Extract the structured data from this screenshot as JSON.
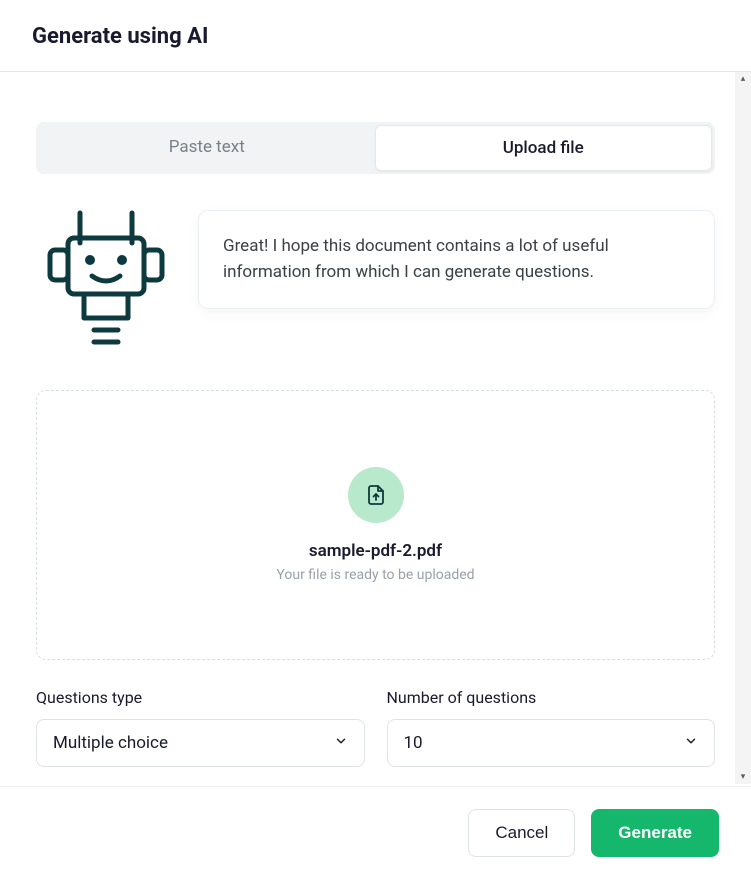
{
  "header": {
    "title": "Generate using AI"
  },
  "tabs": {
    "paste_text": "Paste text",
    "upload_file": "Upload file",
    "active": "upload_file"
  },
  "assistant": {
    "message": "Great! I hope this document contains a lot of useful information from which I can generate questions."
  },
  "dropzone": {
    "file_name": "sample-pdf-2.pdf",
    "hint": "Your file is ready to be uploaded",
    "icon": "file-upload-icon"
  },
  "form": {
    "questions_type": {
      "label": "Questions type",
      "value": "Multiple choice"
    },
    "number_of_questions": {
      "label": "Number of questions",
      "value": "10"
    }
  },
  "footer": {
    "cancel": "Cancel",
    "generate": "Generate"
  },
  "colors": {
    "primary": "#15b76c",
    "text": "#1a1a2e",
    "muted": "#9aa0a8",
    "robot_stroke": "#0d3a3e"
  }
}
